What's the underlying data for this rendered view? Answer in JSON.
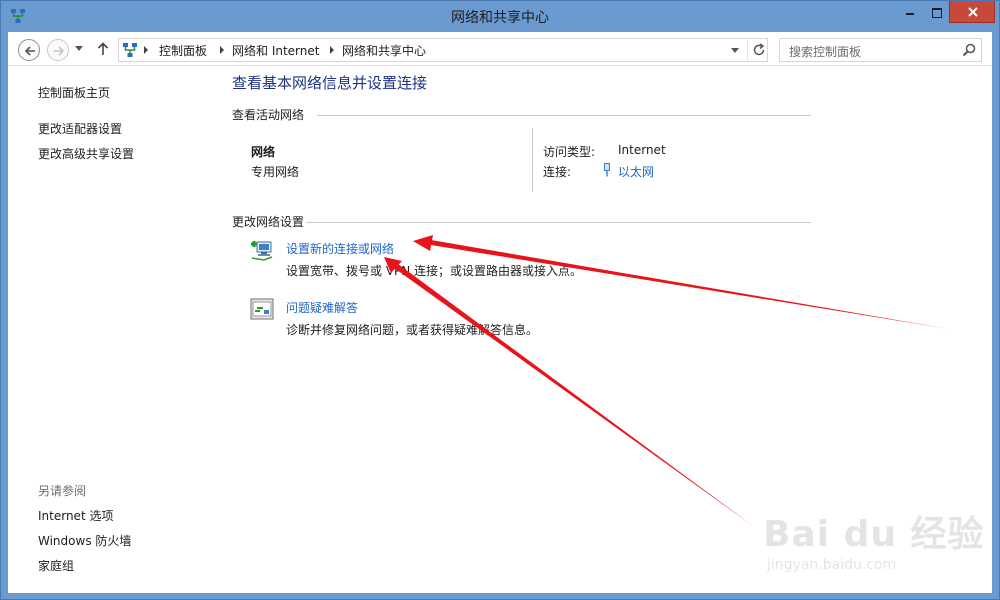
{
  "window": {
    "title": "网络和共享中心",
    "close_color": "#c7493c",
    "frame_color": "#6a9ad0"
  },
  "navbar": {
    "back_icon": "back-arrow-icon",
    "forward_icon": "forward-arrow-icon",
    "up_icon": "up-arrow-icon",
    "breadcrumb": [
      "控制面板",
      "网络和 Internet",
      "网络和共享中心"
    ],
    "refresh_icon": "refresh-icon",
    "search_placeholder": "搜索控制面板",
    "search_icon": "search-icon"
  },
  "sidebar": {
    "home_link": "控制面板主页",
    "links": [
      "更改适配器设置",
      "更改高级共享设置"
    ],
    "see_also_heading": "另请参阅",
    "see_also_links": [
      "Internet 选项",
      "Windows 防火墙",
      "家庭组"
    ]
  },
  "main": {
    "title": "查看基本网络信息并设置连接",
    "active_networks_heading": "查看活动网络",
    "network": {
      "name": "网络",
      "type": "专用网络",
      "access_type_label": "访问类型:",
      "access_type_value": "Internet",
      "connection_label": "连接:",
      "connection_value": "以太网"
    },
    "change_settings_heading": "更改网络设置",
    "tasks": [
      {
        "title": "设置新的连接或网络",
        "description": "设置宽带、拨号或 VPN 连接；或设置路由器或接入点。",
        "icon": "network-setup-icon"
      },
      {
        "title": "问题疑难解答",
        "description": "诊断并修复网络问题，或者获得疑难解答信息。",
        "icon": "troubleshoot-icon"
      }
    ]
  },
  "annotation": {
    "arrow_color": "#e8141b"
  },
  "watermark": {
    "brand": "Bai du 经验",
    "url": "jingyan.baidu.com"
  }
}
